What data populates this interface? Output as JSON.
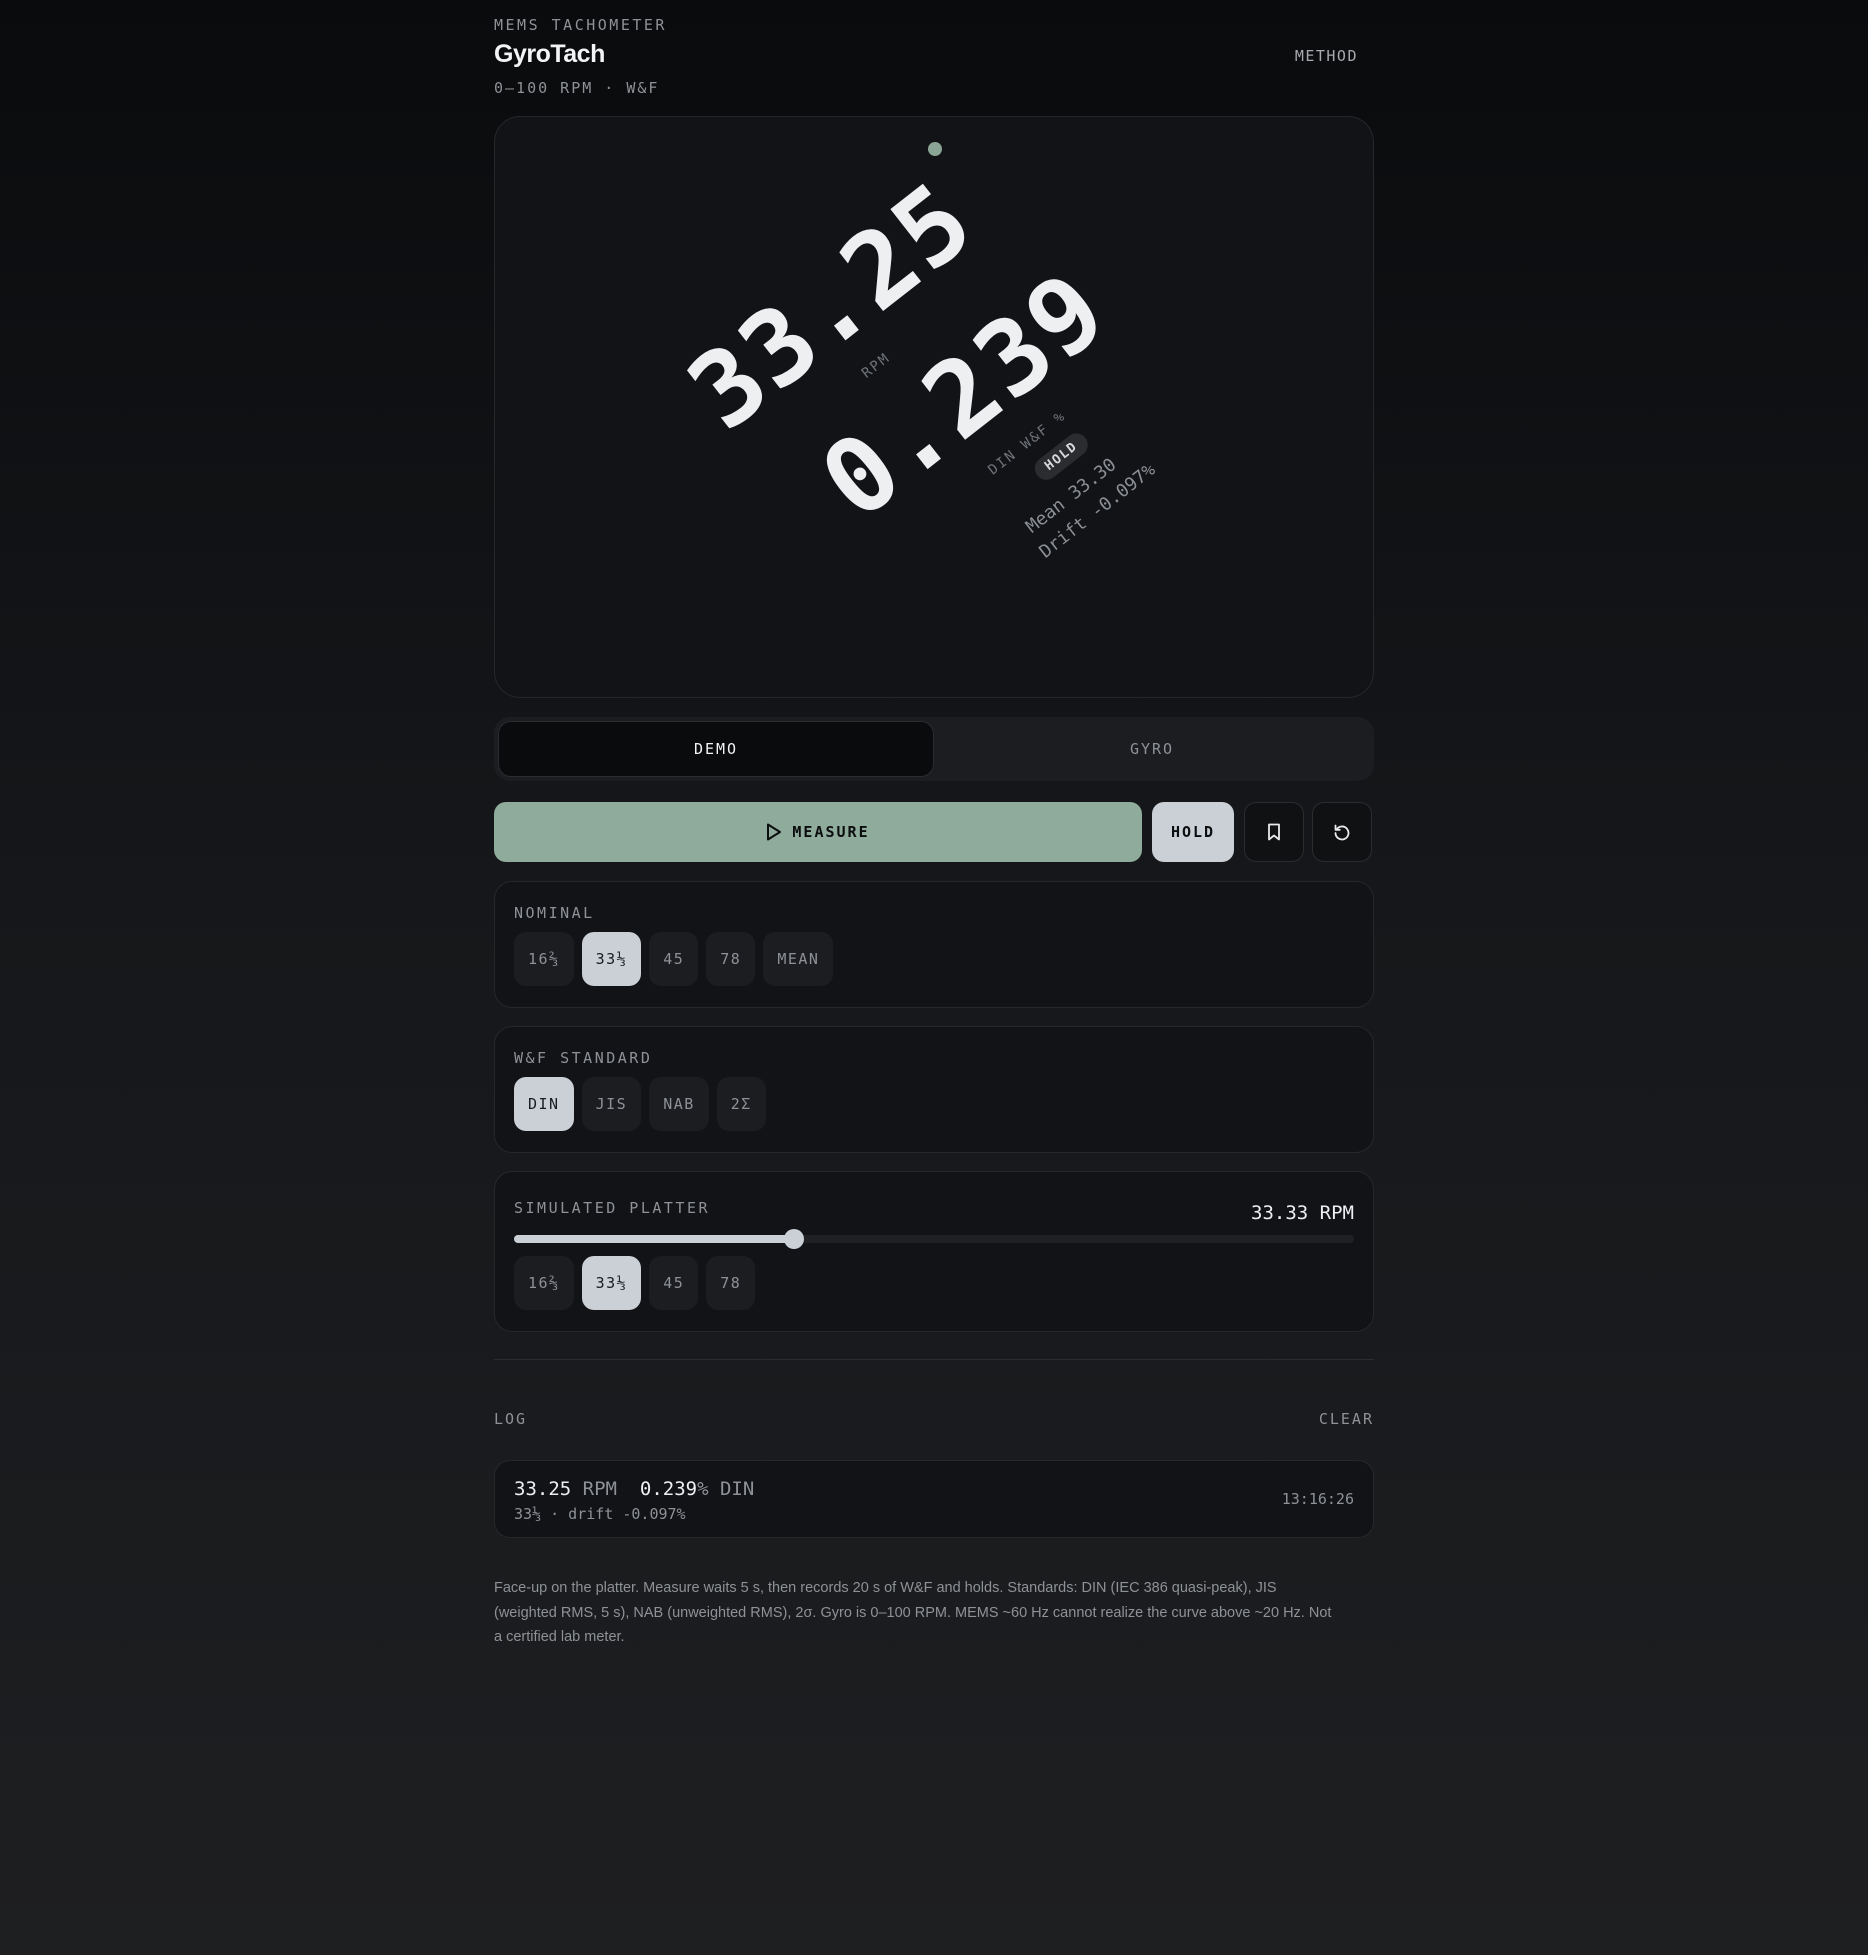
{
  "header": {
    "eyebrow": "MEMS TACHOMETER",
    "title": "GyroTach",
    "subtitle": "0–100 RPM · W&F",
    "method_link": "METHOD"
  },
  "display": {
    "rpm_value": "33.25",
    "rpm_unit": "RPM",
    "wf_value": "0.239",
    "wf_unit": "DIN W&F %",
    "hold_badge": "HOLD",
    "mean_text": "Mean 33.30",
    "drift_text": "Drift -0.097%",
    "status_color": "#8aa596"
  },
  "mode": {
    "options": [
      "DEMO",
      "GYRO"
    ],
    "selected": "DEMO"
  },
  "actions": {
    "measure_label": "MEASURE",
    "hold_label": "HOLD",
    "measure_icon": "play-icon",
    "bookmark_icon": "bookmark-icon",
    "reset_icon": "reset-icon",
    "accent_color": "#8fab9b"
  },
  "nominal": {
    "label": "NOMINAL",
    "options": [
      "16⅔",
      "33⅓",
      "45",
      "78",
      "MEAN"
    ],
    "selected": "33⅓"
  },
  "standard": {
    "label": "W&F STANDARD",
    "options": [
      "DIN",
      "JIS",
      "NAB",
      "2Σ"
    ],
    "selected": "DIN"
  },
  "platter": {
    "label": "SIMULATED PLATTER",
    "readout": "33.33 RPM",
    "value_fraction": 0.3333,
    "options": [
      "16⅔",
      "33⅓",
      "45",
      "78"
    ],
    "selected": "33⅓"
  },
  "log": {
    "title": "LOG",
    "clear_label": "CLEAR",
    "entries": [
      {
        "rpm": "33.25",
        "rpm_unit": "RPM",
        "wf": "0.239",
        "wf_unit": "% DIN",
        "detail": "33⅓ · drift -0.097%",
        "time": "13:16:26"
      }
    ]
  },
  "footnote": "Face-up on the platter. Measure waits 5 s, then records 20 s of W&F and holds. Standards: DIN (IEC 386 quasi-peak), JIS (weighted RMS, 5 s), NAB (unweighted RMS), 2σ. Gyro is 0–100 RPM. MEMS ~60 Hz cannot realize the curve above ~20 Hz. Not a certified lab meter."
}
